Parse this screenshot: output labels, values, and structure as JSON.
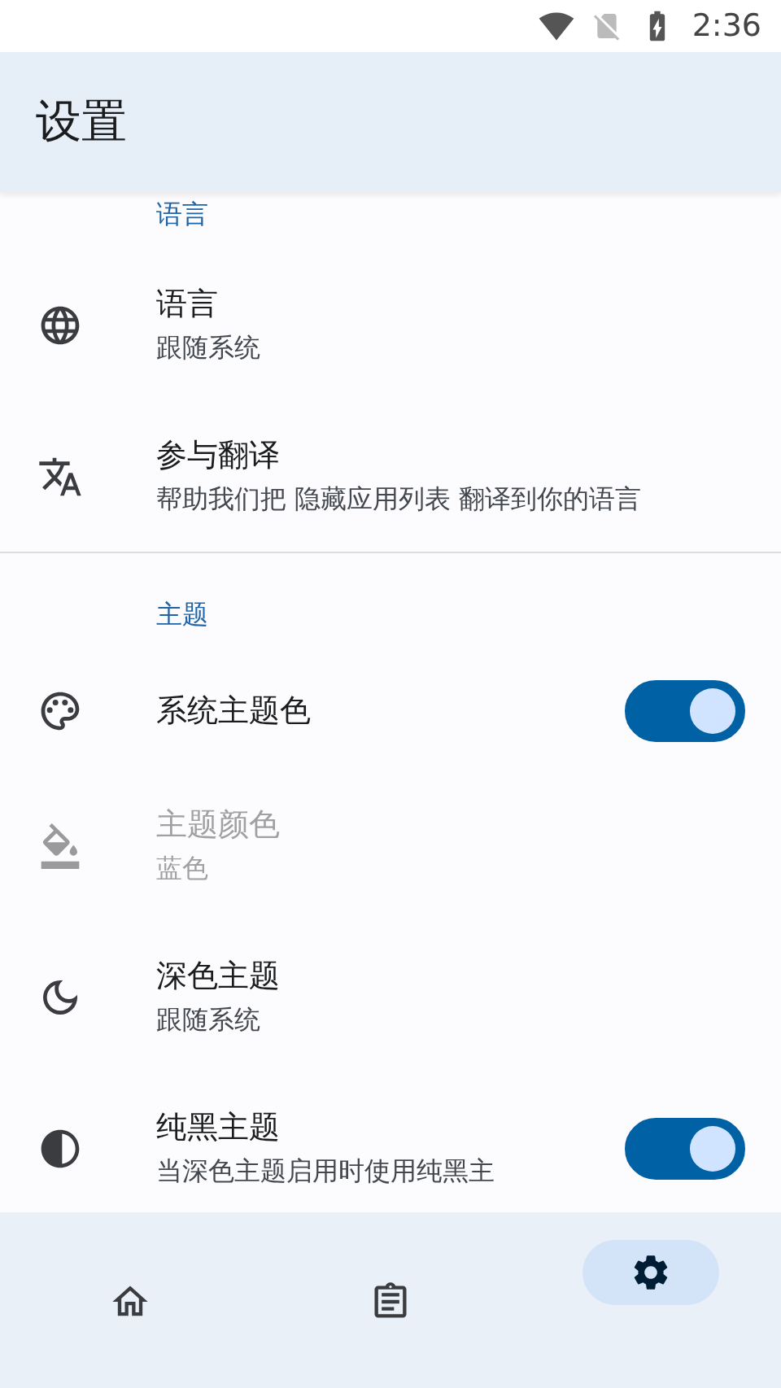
{
  "status_bar": {
    "time": "2:36"
  },
  "app_bar": {
    "title": "设置"
  },
  "sections": [
    {
      "header": "语言",
      "items": [
        {
          "kind": "text",
          "title": "语言",
          "subtitle": "跟随系统",
          "disabled": false
        },
        {
          "kind": "text",
          "title": "参与翻译",
          "subtitle": "帮助我们把 隐藏应用列表 翻译到你的语言",
          "disabled": false
        }
      ]
    },
    {
      "header": "主题",
      "items": [
        {
          "kind": "switch",
          "title": "系统主题色",
          "on": true,
          "disabled": false
        },
        {
          "kind": "text",
          "title": "主题颜色",
          "subtitle": "蓝色",
          "disabled": true
        },
        {
          "kind": "text",
          "title": "深色主题",
          "subtitle": "跟随系统",
          "disabled": false
        },
        {
          "kind": "switch",
          "title": "纯黑主题",
          "subtitle": "当深色主题启用时使用纯黑主",
          "on": true,
          "disabled": false
        }
      ]
    }
  ],
  "nav": [
    {
      "selected": false
    },
    {
      "selected": false
    },
    {
      "selected": true
    }
  ]
}
